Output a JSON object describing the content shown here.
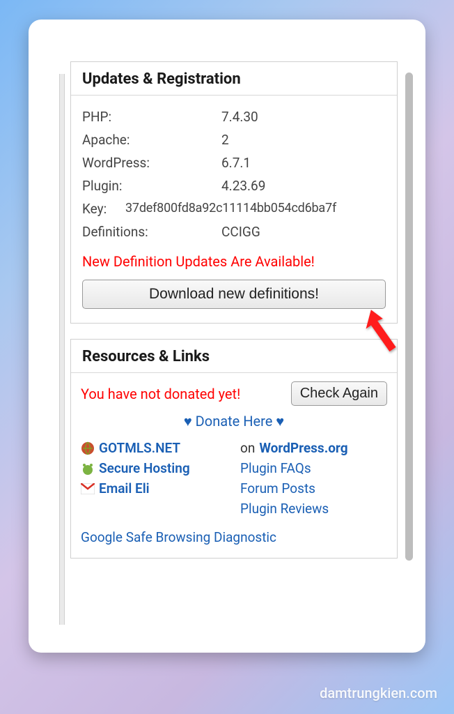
{
  "updates": {
    "title": "Updates & Registration",
    "rows": {
      "php": {
        "label": "PHP:",
        "value": "7.4.30"
      },
      "apache": {
        "label": "Apache:",
        "value": "2"
      },
      "wordpress": {
        "label": "WordPress:",
        "value": "6.7.1"
      },
      "plugin": {
        "label": "Plugin:",
        "value": "4.23.69"
      },
      "key": {
        "label": "Key:",
        "value": "37def800fd8a92c11114bb054cd6ba7f"
      },
      "definitions": {
        "label": "Definitions:",
        "value": "CCIGG"
      }
    },
    "alert": "New Definition Updates Are Available!",
    "download_button": "Download new definitions!"
  },
  "resources": {
    "title": "Resources & Links",
    "donate_warning": "You have not donated yet!",
    "check_button": "Check Again",
    "donate_here": "Donate Here",
    "left_links": {
      "gotmls": "GOTMLS.NET",
      "secure_hosting": "Secure Hosting",
      "email_eli": "Email Eli"
    },
    "right_links": {
      "on_text": "on",
      "wporg": "WordPress.org",
      "faqs": "Plugin FAQs",
      "forum": "Forum Posts",
      "reviews": "Plugin Reviews"
    },
    "gsb": "Google Safe Browsing Diagnostic"
  },
  "watermark": "damtrungkien.com"
}
